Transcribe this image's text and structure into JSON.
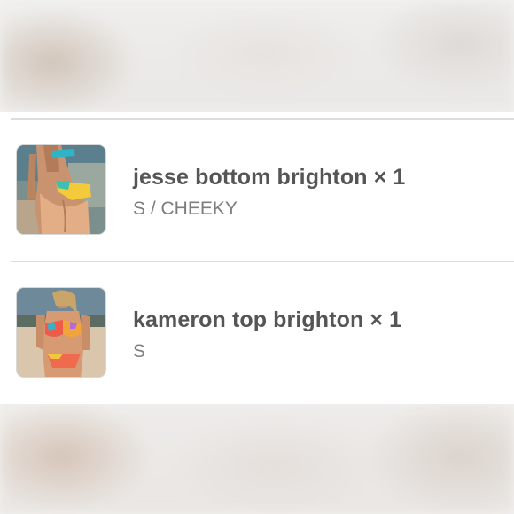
{
  "cart": {
    "items": [
      {
        "title": "jesse bottom brighton × 1",
        "variant": "S / CHEEKY",
        "thumbnail_icon": "product-photo-bikini-bottom"
      },
      {
        "title": "kameron top brighton × 1",
        "variant": "S",
        "thumbnail_icon": "product-photo-bikini-top"
      }
    ]
  },
  "colors": {
    "panel_background": "#ffffff",
    "title_text": "#555555",
    "variant_text": "#7d7d7d",
    "divider": "#dcdcdc"
  }
}
